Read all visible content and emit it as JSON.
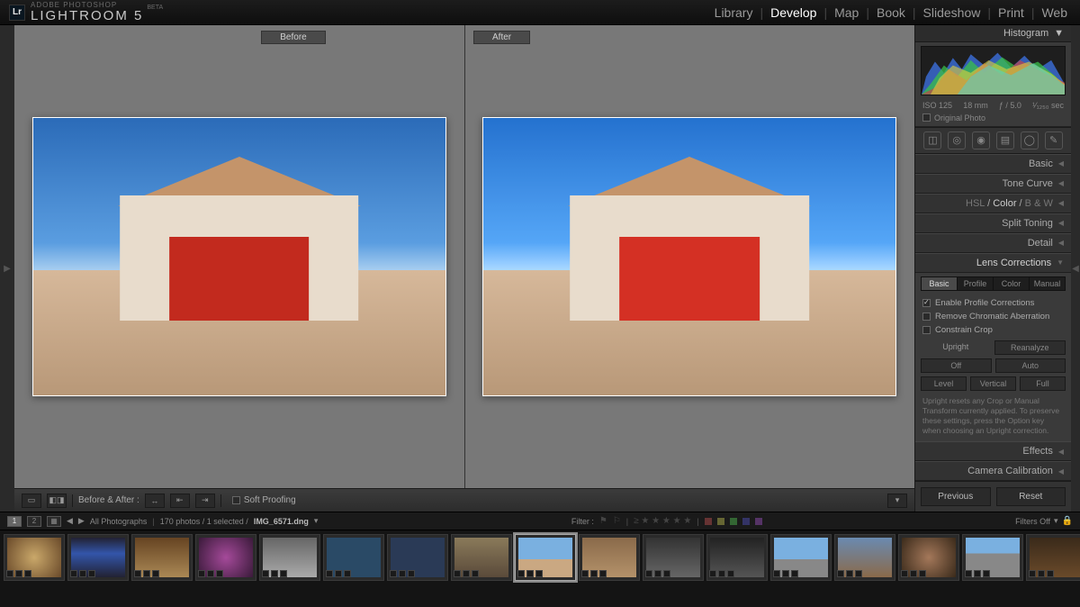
{
  "brand": {
    "small": "ADOBE PHOTOSHOP",
    "big": "LIGHTROOM 5",
    "beta": "BETA"
  },
  "modules": [
    "Library",
    "Develop",
    "Map",
    "Book",
    "Slideshow",
    "Print",
    "Web"
  ],
  "active_module": "Develop",
  "compare": {
    "before": "Before",
    "after": "After"
  },
  "histogram": {
    "title": "Histogram",
    "iso": "ISO 125",
    "focal": "18 mm",
    "aperture": "ƒ / 5.0",
    "shutter": "¹⁄₁₂₅₀ sec",
    "original": "Original Photo"
  },
  "panels": {
    "basic": "Basic",
    "tone_curve": "Tone Curve",
    "hsl": {
      "hsl": "HSL",
      "color": "Color",
      "bw": "B & W"
    },
    "split_toning": "Split Toning",
    "detail": "Detail",
    "lens": "Lens Corrections",
    "effects": "Effects",
    "camera": "Camera Calibration"
  },
  "lens": {
    "tabs": [
      "Basic",
      "Profile",
      "Color",
      "Manual"
    ],
    "active_tab": "Basic",
    "enable_profile": "Enable Profile Corrections",
    "remove_ca": "Remove Chromatic Aberration",
    "constrain": "Constrain Crop",
    "upright": "Upright",
    "reanalyze": "Reanalyze",
    "off": "Off",
    "auto": "Auto",
    "level": "Level",
    "vertical": "Vertical",
    "full": "Full",
    "help": "Upright resets any Crop or Manual Transform currently applied. To preserve these settings, press the Option key when choosing an Upright correction."
  },
  "nav_buttons": {
    "previous": "Previous",
    "reset": "Reset"
  },
  "view_toolbar": {
    "before_after": "Before & After :",
    "soft_proof": "Soft Proofing"
  },
  "strip": {
    "all": "All Photographs",
    "count": "170 photos / 1 selected /",
    "filename": "IMG_6571.dng",
    "filter": "Filter :",
    "filters_off": "Filters Off"
  },
  "thumbs": 17,
  "selected_thumb": 8
}
